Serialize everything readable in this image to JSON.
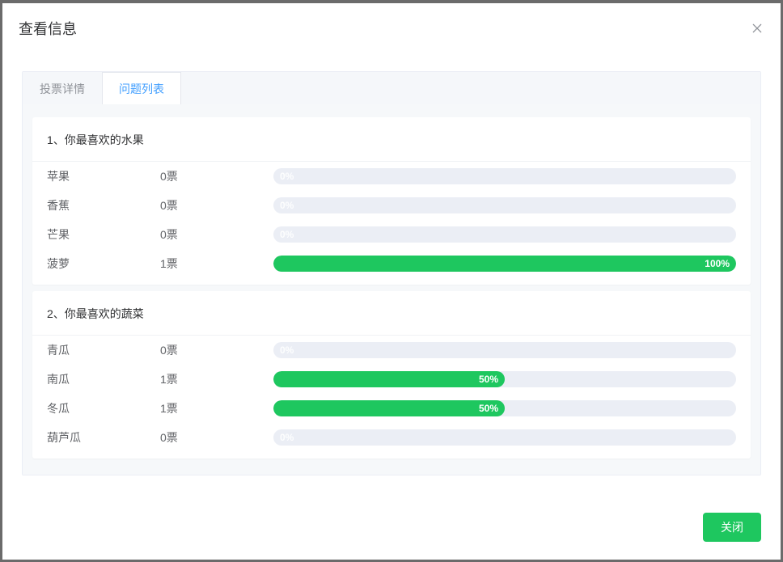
{
  "dialog": {
    "title": "查看信息",
    "close_button_label": "关闭"
  },
  "tabs": [
    {
      "id": "details",
      "label": "投票详情",
      "active": false
    },
    {
      "id": "questions",
      "label": "问题列表",
      "active": true
    }
  ],
  "vote_unit": "票",
  "colors": {
    "bar_fill": "#1ec75f",
    "bar_track": "#ebeef5"
  },
  "questions": [
    {
      "index": "1、",
      "title": "你最喜欢的水果",
      "options": [
        {
          "name": "苹果",
          "count": 0,
          "percent": 0,
          "percent_label": "0%"
        },
        {
          "name": "香蕉",
          "count": 0,
          "percent": 0,
          "percent_label": "0%"
        },
        {
          "name": "芒果",
          "count": 0,
          "percent": 0,
          "percent_label": "0%"
        },
        {
          "name": "菠萝",
          "count": 1,
          "percent": 100,
          "percent_label": "100%"
        }
      ]
    },
    {
      "index": "2、",
      "title": "你最喜欢的蔬菜",
      "options": [
        {
          "name": "青瓜",
          "count": 0,
          "percent": 0,
          "percent_label": "0%"
        },
        {
          "name": "南瓜",
          "count": 1,
          "percent": 50,
          "percent_label": "50%"
        },
        {
          "name": "冬瓜",
          "count": 1,
          "percent": 50,
          "percent_label": "50%"
        },
        {
          "name": "葫芦瓜",
          "count": 0,
          "percent": 0,
          "percent_label": "0%"
        }
      ]
    }
  ]
}
